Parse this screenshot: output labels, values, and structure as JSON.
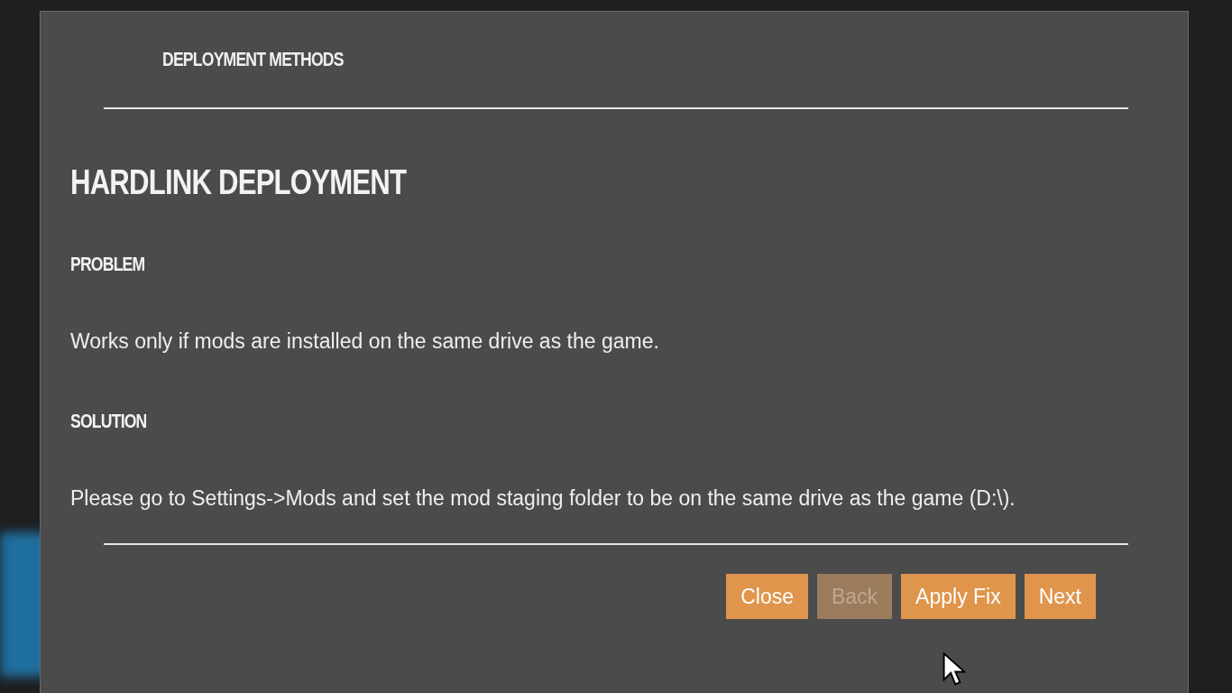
{
  "dialog": {
    "header": "DEPLOYMENT METHODS",
    "title": "HARDLINK DEPLOYMENT",
    "sections": [
      {
        "heading": "PROBLEM",
        "text": "Works only if mods are installed on the same drive as the game."
      },
      {
        "heading": "SOLUTION",
        "text": "Please go to Settings->Mods and set the mod staging folder to be on the same drive as the game (D:\\)."
      }
    ],
    "buttons": [
      {
        "label": "Close",
        "disabled": false
      },
      {
        "label": "Back",
        "disabled": true
      },
      {
        "label": "Apply Fix",
        "disabled": false
      },
      {
        "label": "Next",
        "disabled": false
      }
    ]
  }
}
